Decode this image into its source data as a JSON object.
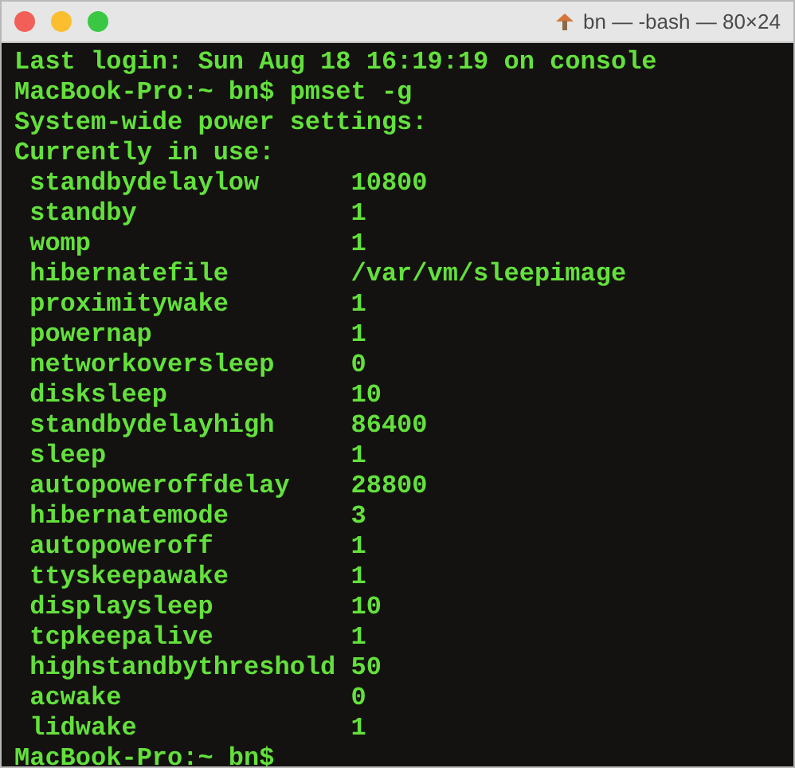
{
  "window": {
    "title": "bn — -bash — 80×24"
  },
  "header_lines": [
    "Last login: Sun Aug 18 16:19:19 on console",
    "MacBook-Pro:~ bn$ pmset -g",
    "System-wide power settings:",
    "Currently in use:"
  ],
  "settings": [
    {
      "name": "standbydelaylow",
      "value": "10800"
    },
    {
      "name": "standby",
      "value": "1"
    },
    {
      "name": "womp",
      "value": "1"
    },
    {
      "name": "hibernatefile",
      "value": "/var/vm/sleepimage"
    },
    {
      "name": "proximitywake",
      "value": "1"
    },
    {
      "name": "powernap",
      "value": "1"
    },
    {
      "name": "networkoversleep",
      "value": "0"
    },
    {
      "name": "disksleep",
      "value": "10"
    },
    {
      "name": "standbydelayhigh",
      "value": "86400"
    },
    {
      "name": "sleep",
      "value": "1"
    },
    {
      "name": "autopoweroffdelay",
      "value": "28800"
    },
    {
      "name": "hibernatemode",
      "value": "3"
    },
    {
      "name": "autopoweroff",
      "value": "1"
    },
    {
      "name": "ttyskeepawake",
      "value": "1"
    },
    {
      "name": "displaysleep",
      "value": "10"
    },
    {
      "name": "tcpkeepalive",
      "value": "1"
    },
    {
      "name": "highstandbythreshold",
      "value": "50"
    },
    {
      "name": "acwake",
      "value": "0"
    },
    {
      "name": "lidwake",
      "value": "1"
    }
  ],
  "prompt": "MacBook-Pro:~ bn$"
}
